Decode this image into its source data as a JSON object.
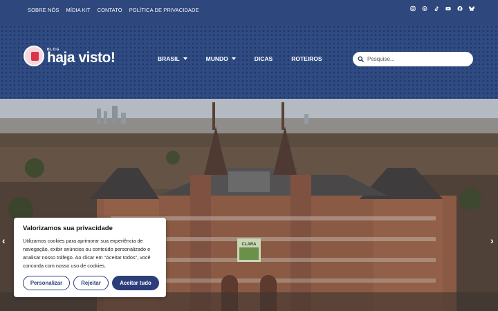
{
  "top_links": [
    "SOBRE NÓS",
    "MÍDIA KIT",
    "CONTATO",
    "POLÍTICA DE PRIVACIDADE"
  ],
  "social_icons": [
    "instagram-icon",
    "threads-icon",
    "tiktok-icon",
    "youtube-icon",
    "facebook-icon",
    "bluesky-icon"
  ],
  "logo": {
    "small": "BLOG",
    "main": "haja visto!"
  },
  "nav": [
    {
      "label": "BRASIL",
      "has_dropdown": true
    },
    {
      "label": "MUNDO",
      "has_dropdown": true
    },
    {
      "label": "DICAS",
      "has_dropdown": false
    },
    {
      "label": "ROTEIROS",
      "has_dropdown": false
    }
  ],
  "search": {
    "placeholder": "Pesquise..."
  },
  "hero": {
    "banner_text": "CLARA"
  },
  "cookie": {
    "title": "Valorizamos sua privacidade",
    "body": "Utilizamos cookies para aprimorar sua experiência de navegação, exibir anúncios ou conteúdo personalizado e analisar nosso tráfego. Ao clicar em “Aceitar todos”, você concorda com nosso uso de cookies.",
    "customize": "Personalizar",
    "reject": "Rejeitar",
    "accept": "Aceitar tudo"
  },
  "colors": {
    "header": "#2f4b82",
    "accent": "#2c3e7a"
  }
}
